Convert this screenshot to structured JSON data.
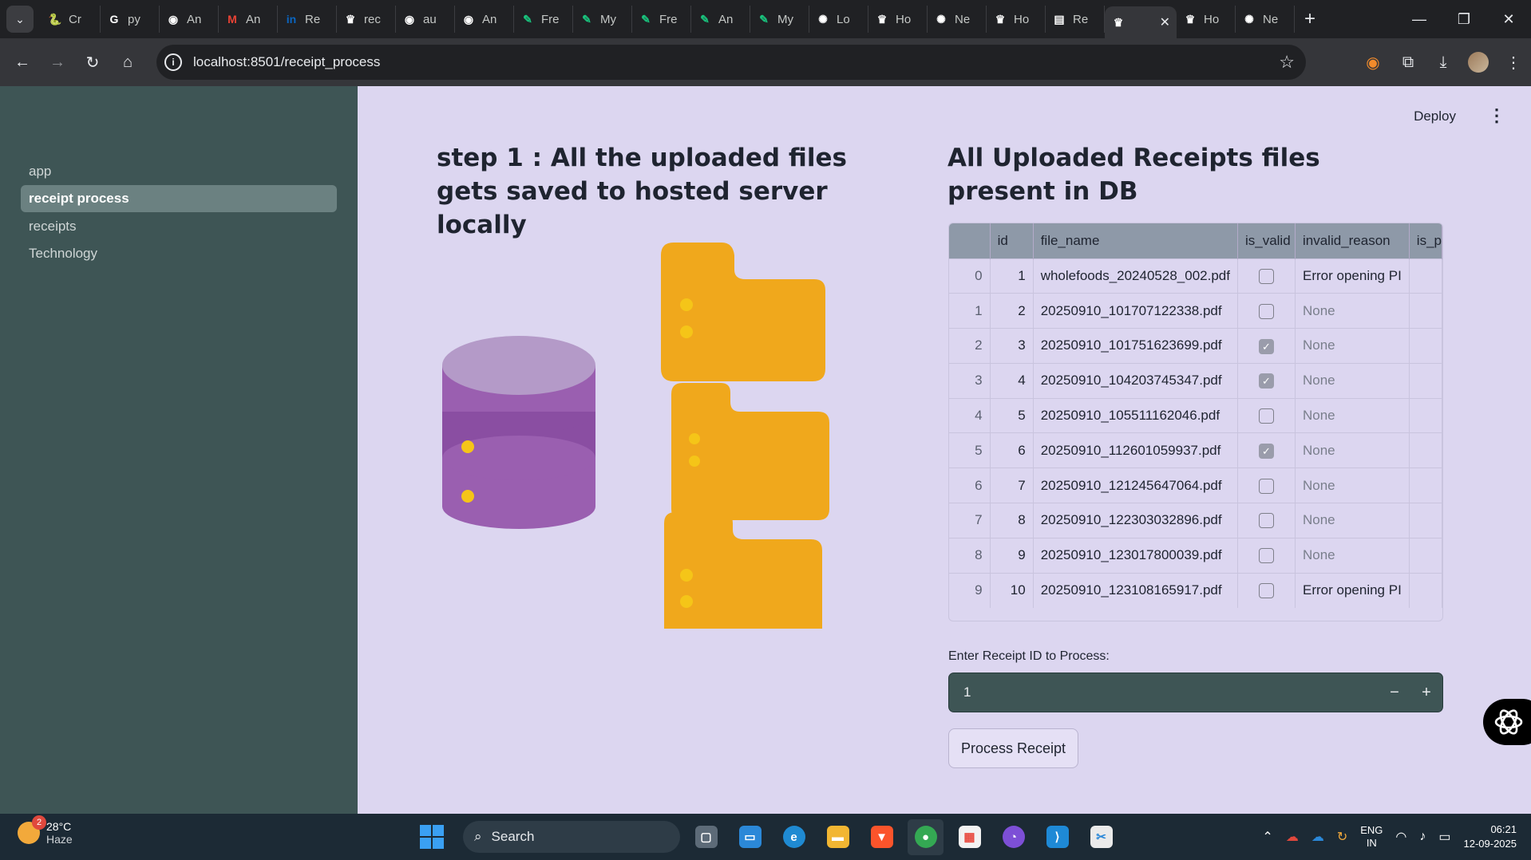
{
  "browser": {
    "tabs": [
      {
        "label": "Cr",
        "icon": "python-icon",
        "color": "#3b78a8"
      },
      {
        "label": "py",
        "icon": "google-icon",
        "color": "#ffffff"
      },
      {
        "label": "An",
        "icon": "github-icon",
        "color": "#ffffff"
      },
      {
        "label": "An",
        "icon": "gmail-icon",
        "color": "#ea4335"
      },
      {
        "label": "Re",
        "icon": "linkedin-icon",
        "color": "#0a66c2"
      },
      {
        "label": "rec",
        "icon": "crown-icon",
        "color": "#ffffff"
      },
      {
        "label": "au",
        "icon": "github-icon",
        "color": "#ffffff"
      },
      {
        "label": "An",
        "icon": "github-icon",
        "color": "#ffffff"
      },
      {
        "label": "Fre",
        "icon": "pen-icon",
        "color": "#19c37d"
      },
      {
        "label": "My",
        "icon": "pen-icon",
        "color": "#19c37d"
      },
      {
        "label": "Fre",
        "icon": "pen-icon",
        "color": "#19c37d"
      },
      {
        "label": "An",
        "icon": "pen-icon",
        "color": "#19c37d"
      },
      {
        "label": "My",
        "icon": "pen-icon",
        "color": "#19c37d"
      },
      {
        "label": "Lo",
        "icon": "openai-icon",
        "color": "#ffffff"
      },
      {
        "label": "Ho",
        "icon": "crown-icon",
        "color": "#ffffff"
      },
      {
        "label": "Ne",
        "icon": "openai-icon",
        "color": "#ffffff"
      },
      {
        "label": "Ho",
        "icon": "crown-icon",
        "color": "#ffffff"
      },
      {
        "label": "Re",
        "icon": "doc-icon",
        "color": "#ffffff"
      },
      {
        "label": "",
        "icon": "crown-icon",
        "color": "#ffffff",
        "active": true
      },
      {
        "label": "Ho",
        "icon": "crown-icon",
        "color": "#ffffff"
      },
      {
        "label": "Ne",
        "icon": "openai-icon",
        "color": "#ffffff"
      }
    ],
    "url": "localhost:8501/receipt_process"
  },
  "sidebar": {
    "items": [
      {
        "label": "app",
        "active": false
      },
      {
        "label": "receipt process",
        "active": true
      },
      {
        "label": "receipts",
        "active": false
      },
      {
        "label": "Technology",
        "active": false
      }
    ]
  },
  "header": {
    "deploy_label": "Deploy",
    "menu_icon": "kebab-icon"
  },
  "step1": {
    "heading": "step 1 : All the uploaded files gets saved to hosted server locally"
  },
  "receipts_panel": {
    "heading": "All Uploaded Receipts files present in DB"
  },
  "table": {
    "columns": [
      "",
      "id",
      "file_name",
      "is_valid",
      "invalid_reason",
      "is_p"
    ],
    "rows": [
      {
        "index": "0",
        "id": "1",
        "file_name": "wholefoods_20240528_002.pdf",
        "is_valid": false,
        "invalid_reason": "Error opening PI"
      },
      {
        "index": "1",
        "id": "2",
        "file_name": "20250910_101707122338.pdf",
        "is_valid": false,
        "invalid_reason": "None"
      },
      {
        "index": "2",
        "id": "3",
        "file_name": "20250910_101751623699.pdf",
        "is_valid": true,
        "invalid_reason": "None"
      },
      {
        "index": "3",
        "id": "4",
        "file_name": "20250910_104203745347.pdf",
        "is_valid": true,
        "invalid_reason": "None"
      },
      {
        "index": "4",
        "id": "5",
        "file_name": "20250910_105511162046.pdf",
        "is_valid": false,
        "invalid_reason": "None"
      },
      {
        "index": "5",
        "id": "6",
        "file_name": "20250910_112601059937.pdf",
        "is_valid": true,
        "invalid_reason": "None"
      },
      {
        "index": "6",
        "id": "7",
        "file_name": "20250910_121245647064.pdf",
        "is_valid": false,
        "invalid_reason": "None"
      },
      {
        "index": "7",
        "id": "8",
        "file_name": "20250910_122303032896.pdf",
        "is_valid": false,
        "invalid_reason": "None"
      },
      {
        "index": "8",
        "id": "9",
        "file_name": "20250910_123017800039.pdf",
        "is_valid": false,
        "invalid_reason": "None"
      },
      {
        "index": "9",
        "id": "10",
        "file_name": "20250910_123108165917.pdf",
        "is_valid": false,
        "invalid_reason": "Error opening PI"
      }
    ]
  },
  "receipt_input": {
    "label": "Enter Receipt ID to Process:",
    "value": "1",
    "minus": "−",
    "plus": "+"
  },
  "process_button": {
    "label": "Process Receipt"
  },
  "taskbar": {
    "weather": {
      "temp": "28°C",
      "condition": "Haze",
      "badge": "2"
    },
    "search_label": "Search",
    "lang_line1": "ENG",
    "lang_line2": "IN",
    "time": "06:21",
    "date": "12-09-2025"
  },
  "colors": {
    "sidebar_bg": "#3e5555",
    "main_bg": "#dcd6f0",
    "database": "#9a5fb0",
    "folder": "#f0a81c",
    "dot": "#f5c518"
  }
}
